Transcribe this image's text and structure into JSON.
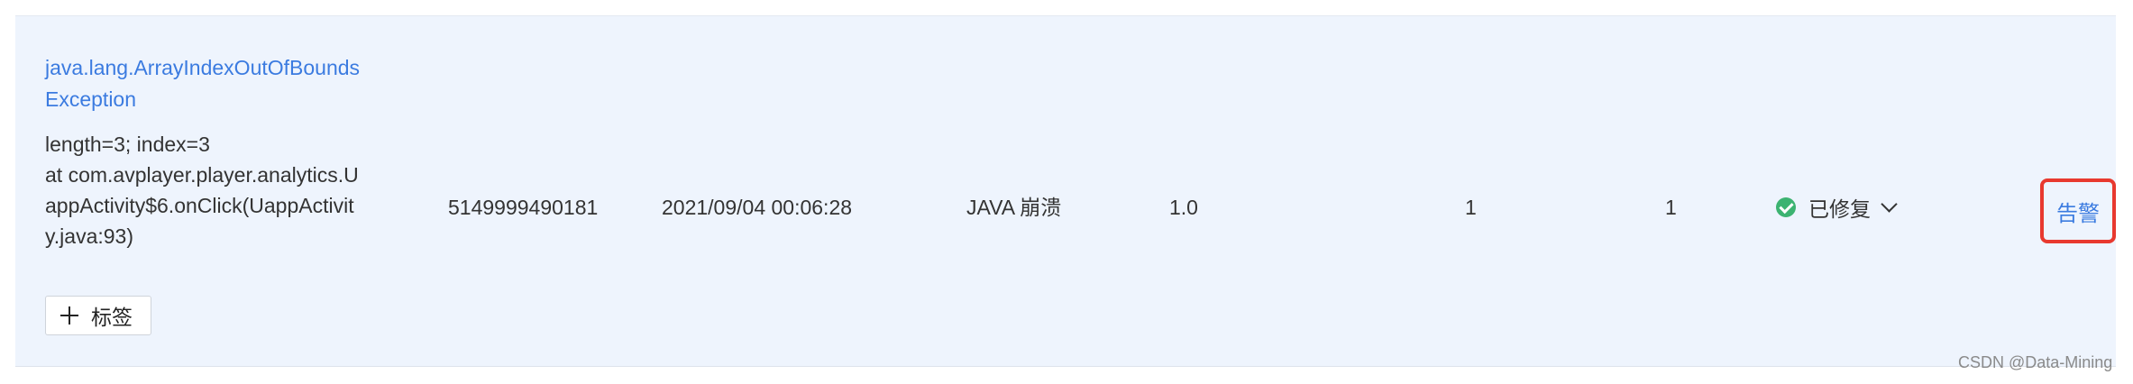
{
  "error": {
    "title_line1": "java.lang.ArrayIndexOutOfBounds",
    "title_line2": "Exception",
    "detail_lines": [
      "length=3; index=3",
      "at com.avplayer.player.analytics.U",
      "appActivity$6.onClick(UappActivit",
      "y.java:93)"
    ]
  },
  "tag_button_label": "标签",
  "columns": {
    "id": "5149999490181",
    "time": "2021/09/04 00:06:28",
    "type": "JAVA 崩溃",
    "version": "1.0",
    "count_a": "1",
    "count_b": "1"
  },
  "status": {
    "label": "已修复",
    "icon": "check-circle-icon",
    "color": "#3cb371"
  },
  "action": {
    "label": "告警",
    "highlight_color": "#e8392f"
  },
  "watermark": "CSDN @Data-Mining"
}
